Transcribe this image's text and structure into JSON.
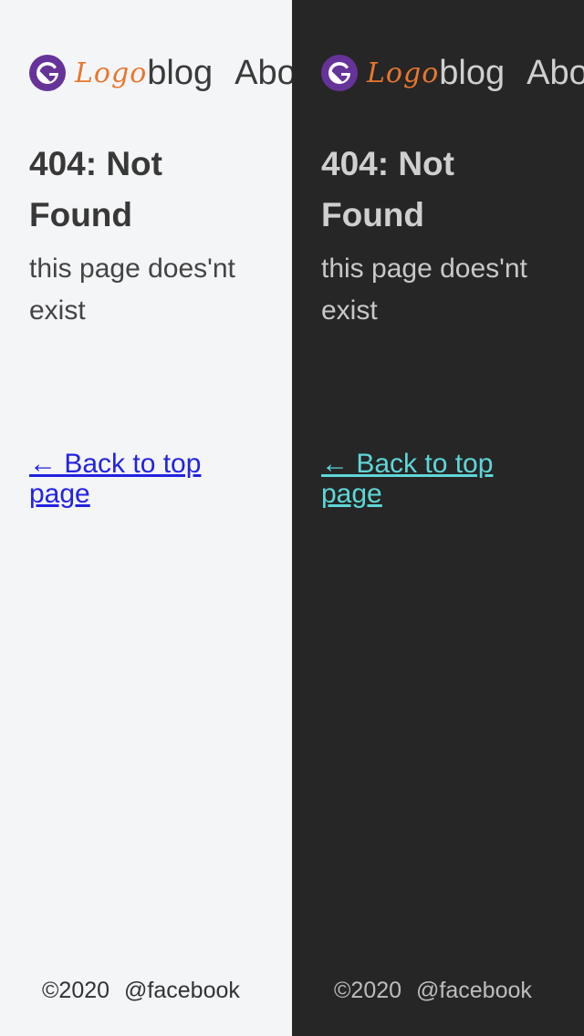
{
  "light": {
    "header": {
      "logo_text": "Logo",
      "nav_items": [
        "blog",
        "About"
      ]
    },
    "main": {
      "title": "404: Not Found",
      "description": "this page does'nt exist",
      "back_link": "← Back to top page"
    },
    "footer": {
      "copyright": "©2020",
      "social": "@facebook"
    }
  },
  "dark": {
    "header": {
      "logo_text": "Logo",
      "nav_items": [
        "blog",
        "About"
      ]
    },
    "main": {
      "title": "404: Not Found",
      "description": "this page does'nt exist",
      "back_link": "← Back to top page"
    },
    "footer": {
      "copyright": "©2020",
      "social": "@facebook"
    }
  },
  "theme": {
    "light_bg": "#f4f5f7",
    "dark_bg": "#262626",
    "gatsby_purple": "#663399",
    "logo_orange": "#e8772e",
    "light_link": "#2323e0",
    "dark_link": "#5fd6d6"
  },
  "icons": {
    "site_icon": "gatsby-icon"
  }
}
